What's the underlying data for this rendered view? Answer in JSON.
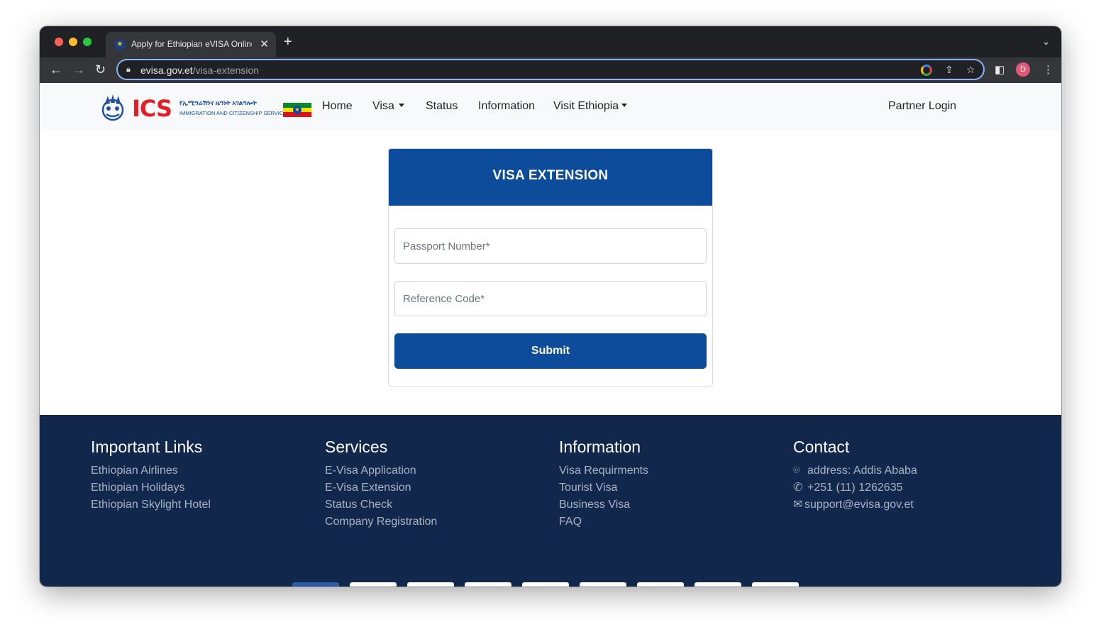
{
  "browser": {
    "tab_title": "Apply for Ethiopian eVISA Online",
    "new_tab": "+",
    "close_tab": "✕",
    "url_host": "evisa.gov.et",
    "url_path": "/visa-extension",
    "profile_initial": "D"
  },
  "nav": {
    "logo_text": "ICS",
    "logo_amharic": "የኢሚግሬሽንና ዜግነት አገልግሎት",
    "logo_subtitle": "IMMIGRATION AND CITIZENSHIP SERVICE",
    "items": [
      {
        "label": "Home"
      },
      {
        "label": "Visa"
      },
      {
        "label": "Status"
      },
      {
        "label": "Information"
      },
      {
        "label": "Visit Ethiopia"
      }
    ],
    "partner_login": "Partner Login"
  },
  "form": {
    "title": "VISA EXTENSION",
    "passport_placeholder": "Passport Number*",
    "reference_placeholder": "Reference Code*",
    "submit_label": "Submit"
  },
  "footer": {
    "columns": [
      {
        "heading": "Important Links",
        "links": [
          "Ethiopian Airlines",
          "Ethiopian Holidays",
          "Ethiopian Skylight Hotel"
        ]
      },
      {
        "heading": "Services",
        "links": [
          "E-Visa Application",
          "E-Visa Extension",
          "Status Check",
          "Company Registration"
        ]
      },
      {
        "heading": "Information",
        "links": [
          "Visa Requirments",
          "Tourist Visa",
          "Business Visa",
          "FAQ"
        ]
      },
      {
        "heading": "Contact",
        "links": [
          "address: Addis Ababa",
          "+251 (11) 1262635",
          "support@evisa.gov.et"
        ]
      }
    ]
  },
  "colors": {
    "primary": "#0d4c9b",
    "footer_bg": "#11284c",
    "logo_red": "#e31e24"
  }
}
